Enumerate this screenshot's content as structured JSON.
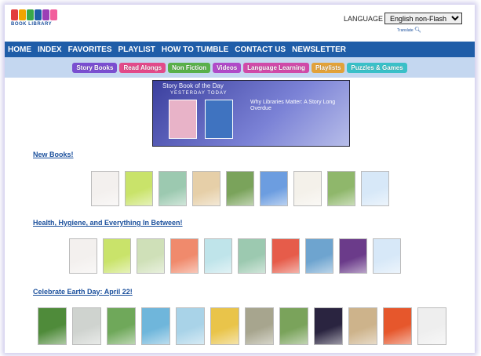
{
  "header": {
    "logo_colors": [
      "#e23b3b",
      "#f2a400",
      "#3aa84a",
      "#1f5da8",
      "#9b3fb6",
      "#f25f9c"
    ],
    "logo_caption": "BOOK LIBRARY",
    "language_label": "LANGUAGE",
    "language_selected": "English non-Flash",
    "translate_text": "Translate"
  },
  "nav": {
    "items": [
      "HOME",
      "INDEX",
      "FAVORITES",
      "PLAYLIST",
      "HOW TO TUMBLE",
      "CONTACT US",
      "NEWSLETTER"
    ]
  },
  "subnav": {
    "items": [
      {
        "label": "Story Books",
        "color": "#7a4fd0"
      },
      {
        "label": "Read Alongs",
        "color": "#e24a8a"
      },
      {
        "label": "Non Fiction",
        "color": "#59b04a"
      },
      {
        "label": "Videos",
        "color": "#b04ac8"
      },
      {
        "label": "Language Learning",
        "color": "#d04aa8"
      },
      {
        "label": "Playlists",
        "color": "#e2a23a"
      },
      {
        "label": "Puzzles & Games",
        "color": "#3ac0c8"
      }
    ]
  },
  "story_of_the_day": {
    "title": "Story Book of the Day",
    "subtitle": "YESTERDAY TODAY",
    "feature_title": "Why Libraries Matter: A Story Long Overdue"
  },
  "sections": [
    {
      "title": "New Books!",
      "covers": [
        "#f3f0ee",
        "#c9e36a",
        "#9cc9b0",
        "#e6cfa8",
        "#7aa35b",
        "#6c9de0",
        "#f4f1ea",
        "#8fb76b",
        "#d7e8f8"
      ]
    },
    {
      "title": "Health, Hygiene, and Everything In Between!",
      "covers": [
        "#f3f0ee",
        "#c9e36a",
        "#cfe0b8",
        "#f08a6c",
        "#bfe4ea",
        "#9cc9b0",
        "#e65c4a",
        "#6ea4cf",
        "#6b3b8a",
        "#d7e8f8"
      ]
    },
    {
      "title": "Celebrate Earth Day: April 22!",
      "covers": [
        "#4f8b3a",
        "#cfd3cf",
        "#6fa85a",
        "#6fb6db",
        "#a9d3e8",
        "#e9c44a",
        "#a7a58e",
        "#7aa35b",
        "#2a2440",
        "#cdb38b",
        "#e6572c",
        "#eeeeee"
      ]
    }
  ]
}
